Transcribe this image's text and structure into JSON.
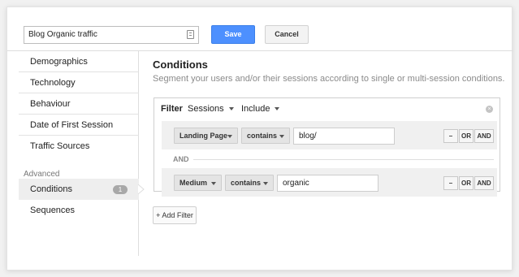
{
  "header": {
    "segment_name": "Blog Organic traffic",
    "save_label": "Save",
    "cancel_label": "Cancel"
  },
  "sidebar": {
    "items": [
      "Demographics",
      "Technology",
      "Behaviour",
      "Date of First Session",
      "Traffic Sources"
    ],
    "section_label": "Advanced",
    "active": {
      "label": "Conditions",
      "count": "1"
    },
    "after": "Sequences"
  },
  "main": {
    "title": "Conditions",
    "description": "Segment your users and/or their sessions according to single or multi-session conditions.",
    "filter": {
      "label": "Filter",
      "scope": "Sessions",
      "mode": "Include",
      "and_label": "AND",
      "conditions": [
        {
          "dimension": "Landing Page",
          "operator": "contains",
          "value": "blog/",
          "minus": "–",
          "or": "OR",
          "and": "AND"
        },
        {
          "dimension": "Medium",
          "operator": "contains",
          "value": "organic",
          "minus": "–",
          "or": "OR",
          "and": "AND"
        }
      ]
    },
    "add_filter_label": "+ Add Filter"
  }
}
